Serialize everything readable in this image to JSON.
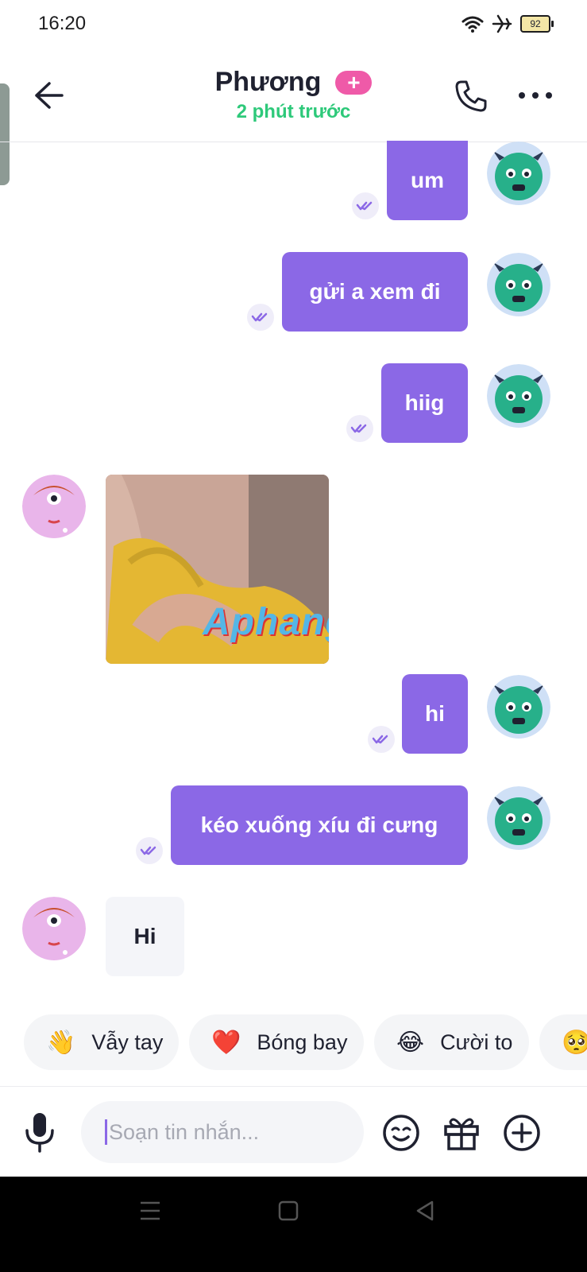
{
  "status": {
    "time": "16:20",
    "battery": "92"
  },
  "header": {
    "name": "Phương",
    "plus": "+",
    "last_seen": "2 phút trước"
  },
  "messages": [
    {
      "from": "me",
      "text": "um"
    },
    {
      "from": "me",
      "text": "gửi a xem đi"
    },
    {
      "from": "me",
      "text": "hiig"
    },
    {
      "from": "other",
      "type": "image",
      "watermark": "Aphang"
    },
    {
      "from": "me",
      "text": "hi"
    },
    {
      "from": "me",
      "text": "kéo xuống xíu đi cưng"
    },
    {
      "from": "other",
      "text": "Hi"
    }
  ],
  "reactions": [
    {
      "emoji": "👋",
      "label": "Vẫy tay"
    },
    {
      "emoji": "❤️",
      "label": "Bóng bay"
    },
    {
      "emoji": "😂",
      "label": "Cười to"
    },
    {
      "emoji": "🥺",
      "label": ""
    }
  ],
  "composer": {
    "placeholder": "Soạn tin nhắn..."
  },
  "colors": {
    "accent": "#8b68e6",
    "online": "#2ec97a",
    "badge": "#ef5aa8"
  }
}
